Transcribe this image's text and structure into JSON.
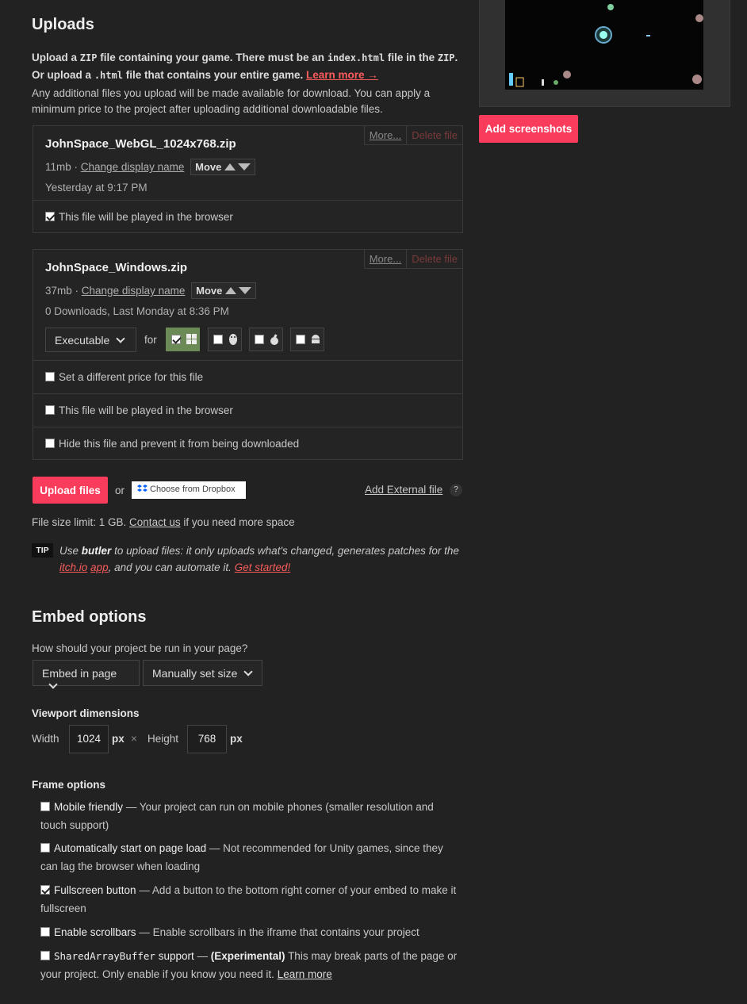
{
  "uploads": {
    "title": "Uploads",
    "intro_1": "Upload a",
    "zip_code": "ZIP",
    "intro_2": "file containing your game. There must be an",
    "index_code": "index.html",
    "intro_3": "file in the",
    "zip_code_2": "ZIP",
    "intro_4": ". Or",
    "intro_5": "upload a",
    "html_code": ".html",
    "intro_6": "file that contains your entire game.",
    "learn_more": "Learn more →",
    "additional_note": "Any additional files you upload will be made available for download. You can apply a minimum price to the project after uploading additional downloadable files.",
    "files": [
      {
        "name": "JohnSpace_WebGL_1024x768.zip",
        "size": "11mb",
        "change_name": "Change display name",
        "move": "Move",
        "info": "Yesterday at 9:17 PM",
        "more": "More...",
        "delete": "Delete file",
        "played_in_browser": "This file will be played in the browser",
        "played_checked": true
      },
      {
        "name": "JohnSpace_Windows.zip",
        "size": "37mb",
        "change_name": "Change display name",
        "move": "Move",
        "info": "0 Downloads, Last Monday at 8:36 PM",
        "more": "More...",
        "delete": "Delete file",
        "type": "Executable",
        "for_label": "for",
        "platforms": [
          {
            "name": "windows-icon",
            "checked": true
          },
          {
            "name": "linux-icon",
            "checked": false
          },
          {
            "name": "apple-icon",
            "checked": false
          },
          {
            "name": "android-icon",
            "checked": false
          }
        ],
        "price_option": "Set a different price for this file",
        "played_in_browser": "This file will be played in the browser",
        "hide_option": "Hide this file and prevent it from being downloaded"
      }
    ],
    "upload_button": "Upload files",
    "or": "or",
    "dropbox": "Choose from Dropbox",
    "add_external": "Add External file",
    "help": "?",
    "size_limit": "File size limit: 1 GB.",
    "contact_us": "Contact us",
    "size_limit_2": "if you need more space",
    "tip_badge": "TIP",
    "tip_1": "Use",
    "tip_butler": "butler",
    "tip_2": "to upload files: it only uploads what's changed, generates patches for the",
    "tip_itch": "itch.io",
    "tip_app": "app",
    "tip_3": ", and you can automate it.",
    "tip_get_started": "Get started!"
  },
  "embed": {
    "title": "Embed options",
    "question": "How should your project be run in your page?",
    "mode": "Embed in page",
    "size_mode": "Manually set size",
    "viewport_title": "Viewport dimensions",
    "width_label": "Width",
    "width": "1024",
    "px": "px",
    "times": "×",
    "height_label": "Height",
    "height": "768",
    "frame_title": "Frame options",
    "frame_options": [
      {
        "label": "Mobile friendly",
        "desc": "— Your project can run on mobile phones (smaller resolution and touch support)",
        "checked": false
      },
      {
        "label": "Automatically start on page load",
        "desc": "— Not recommended for Unity games, since they can lag the browser when loading",
        "checked": false
      },
      {
        "label": "Fullscreen button",
        "desc": "— Add a button to the bottom right corner of your embed to make it fullscreen",
        "checked": true
      },
      {
        "label": "Enable scrollbars",
        "desc": "— Enable scrollbars in the iframe that contains your project",
        "checked": false
      }
    ],
    "sab_code": "SharedArrayBuffer",
    "sab_label": "support",
    "sab_dash": "—",
    "sab_exp": "(Experimental)",
    "sab_desc": "This may break parts of the page or your project. Only enable if you know you need it.",
    "sab_learn": "Learn more"
  },
  "sidebar": {
    "add_screenshots": "Add screenshots"
  },
  "colors": {
    "accent": "#fa3c5c",
    "background": "#222222",
    "windows_selected": "#6b8a55"
  }
}
